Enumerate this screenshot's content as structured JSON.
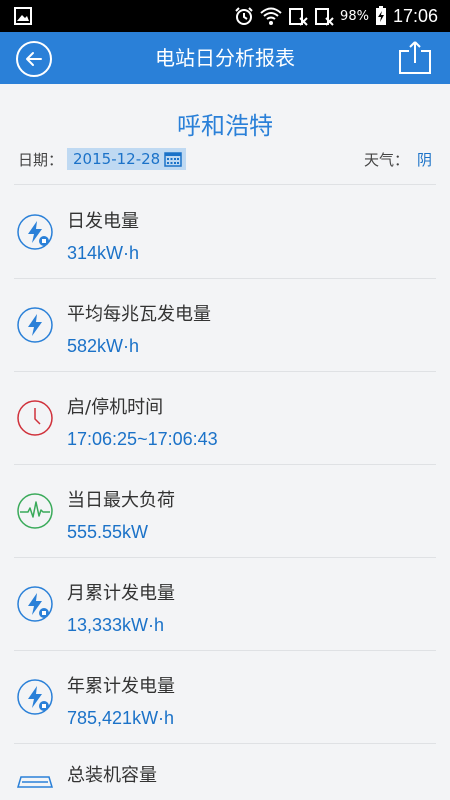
{
  "status_bar": {
    "battery_percent": "98%",
    "time": "17:06",
    "icons": [
      "image-icon",
      "alarm-icon",
      "wifi-icon",
      "sim-icon",
      "sim-icon",
      "battery-charging-icon"
    ]
  },
  "header": {
    "title": "电站日分析报表",
    "back_icon": "back-arrow-circle-icon",
    "share_icon": "share-upload-icon"
  },
  "station": {
    "name": "呼和浩特"
  },
  "date": {
    "label": "日期：",
    "value": "2015-12-28"
  },
  "weather": {
    "label": "天气：",
    "value": "阴"
  },
  "metrics": [
    {
      "label": "日发电量",
      "value": "314kW·h",
      "icon": "lightning-day-icon"
    },
    {
      "label": "平均每兆瓦发电量",
      "value": "582kW·h",
      "icon": "lightning-icon"
    },
    {
      "label": "启/停机时间",
      "value": "17:06:25~17:06:43",
      "icon": "clock-icon"
    },
    {
      "label": "当日最大负荷",
      "value": "555.55kW",
      "icon": "pulse-icon"
    },
    {
      "label": "月累计发电量",
      "value": "13,333kW·h",
      "icon": "lightning-month-icon"
    },
    {
      "label": "年累计发电量",
      "value": "785,421kW·h",
      "icon": "lightning-year-icon"
    },
    {
      "label": "总装机容量",
      "value": "",
      "icon": "solar-panel-icon"
    }
  ],
  "colors": {
    "primary": "#2a80d8",
    "value_text": "#1b72c8",
    "clock_red": "#d0313b",
    "pulse_green": "#3aaa5a"
  }
}
